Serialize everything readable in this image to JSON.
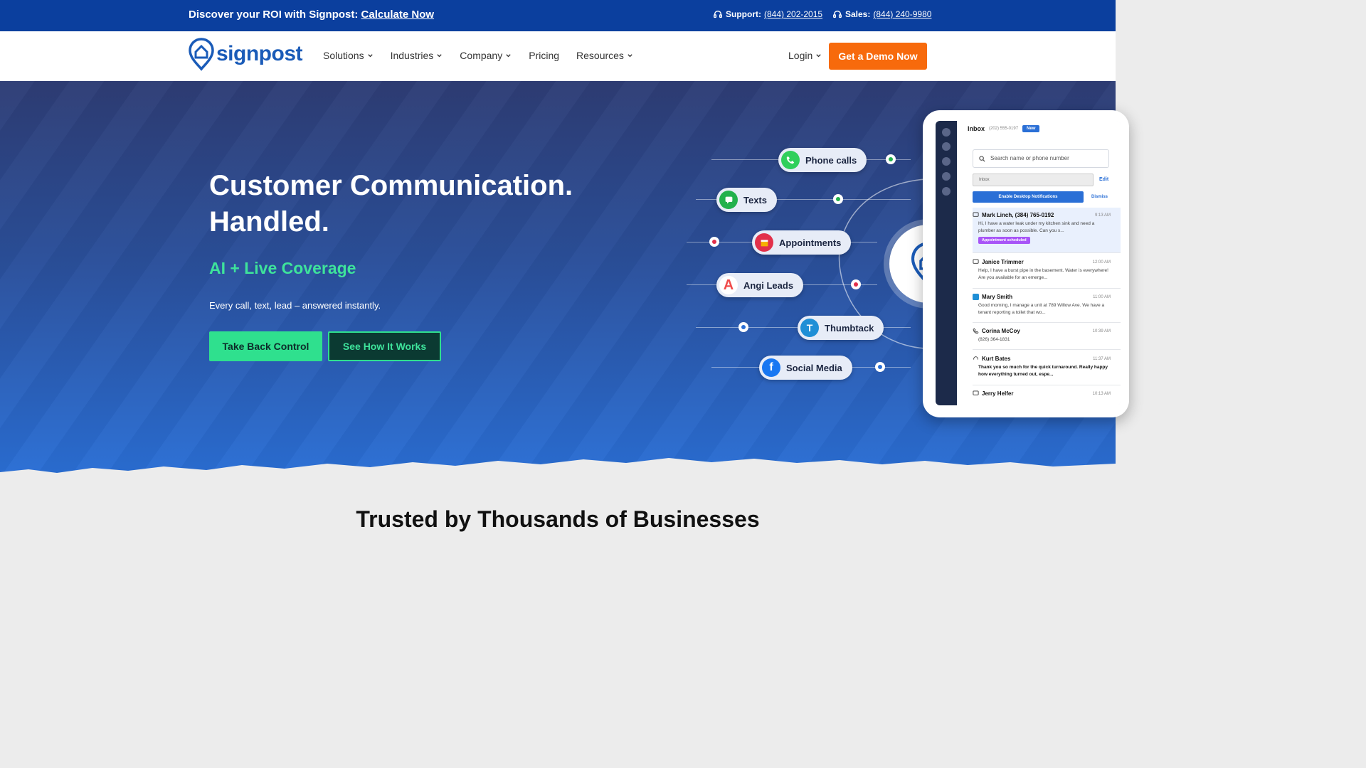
{
  "topbar": {
    "promo_text": "Discover your ROI with Signpost:",
    "promo_link": "Calculate Now",
    "support_label": "Support:",
    "support_phone": "(844) 202-2015",
    "sales_label": "Sales:",
    "sales_phone": "(844) 240-9980"
  },
  "nav": {
    "logo_text": "signpost",
    "items": [
      {
        "label": "Solutions"
      },
      {
        "label": "Industries"
      },
      {
        "label": "Company"
      },
      {
        "label": "Pricing"
      },
      {
        "label": "Resources"
      }
    ],
    "login_label": "Login",
    "demo_label": "Get a Demo Now"
  },
  "hero": {
    "title_line1": "Customer Communication.",
    "title_line2": "Handled.",
    "subtitle": "AI + Live Coverage",
    "description": "Every call, text, lead – answered instantly.",
    "primary_cta": "Take Back Control",
    "secondary_cta": "See How It Works"
  },
  "channels": [
    {
      "label": "Phone calls",
      "icon": "phone-icon",
      "color": "#2fcf5b"
    },
    {
      "label": "Texts",
      "icon": "chat-icon",
      "color": "#22b14c"
    },
    {
      "label": "Appointments",
      "icon": "calendar-icon",
      "color": "#e2304a"
    },
    {
      "label": "Angi Leads",
      "icon": "angi-logo-icon",
      "color": "#f04b4b"
    },
    {
      "label": "Thumbtack",
      "icon": "thumbtack-logo-icon",
      "color": "#1f8fd6"
    },
    {
      "label": "Social Media",
      "icon": "facebook-icon",
      "color": "#1877f2"
    }
  ],
  "inbox": {
    "title": "Inbox",
    "phone": "(202) 555-0197",
    "new_label": "New",
    "search_placeholder": "Search name or phone number",
    "filter_value": "Inbox",
    "edit_label": "Edit",
    "notif_label": "Enable Desktop Notifications",
    "dismiss_label": "Dismiss",
    "messages": [
      {
        "name": "Mark Linch, (384) 765-0192",
        "time": "9:13 AM",
        "body": "Hi, I have a water leak under my kitchen sink and need a plumber as soon as possible. Can you s...",
        "tag": "Appointment scheduled"
      },
      {
        "name": "Janice Trimmer",
        "time": "12:00 AM",
        "body": "Help, I have a burst pipe in the basement. Water is everywhere! Are you available for an emerge..."
      },
      {
        "name": "Mary Smith",
        "time": "11:00 AM",
        "body": "Good morning, I manage a unit at 789 Willow Ave. We have a tenant reporting a toilet that wo..."
      },
      {
        "name": "Corina McCoy",
        "time": "10:39 AM",
        "body": "(826) 364-1831"
      },
      {
        "name": "Kurt Bates",
        "time": "11:37 AM",
        "body": "Thank you so much for the quick turnaround. Really happy how everything turned out, espe..."
      },
      {
        "name": "Jerry Helfer",
        "time": "10:13 AM",
        "body": ""
      }
    ]
  },
  "trusted": {
    "heading": "Trusted by Thousands of Businesses"
  },
  "colors": {
    "topbar": "#0b3f9e",
    "accent_orange": "#f76a0c",
    "accent_green": "#2fe08e",
    "brand_blue": "#1a5bb8"
  }
}
